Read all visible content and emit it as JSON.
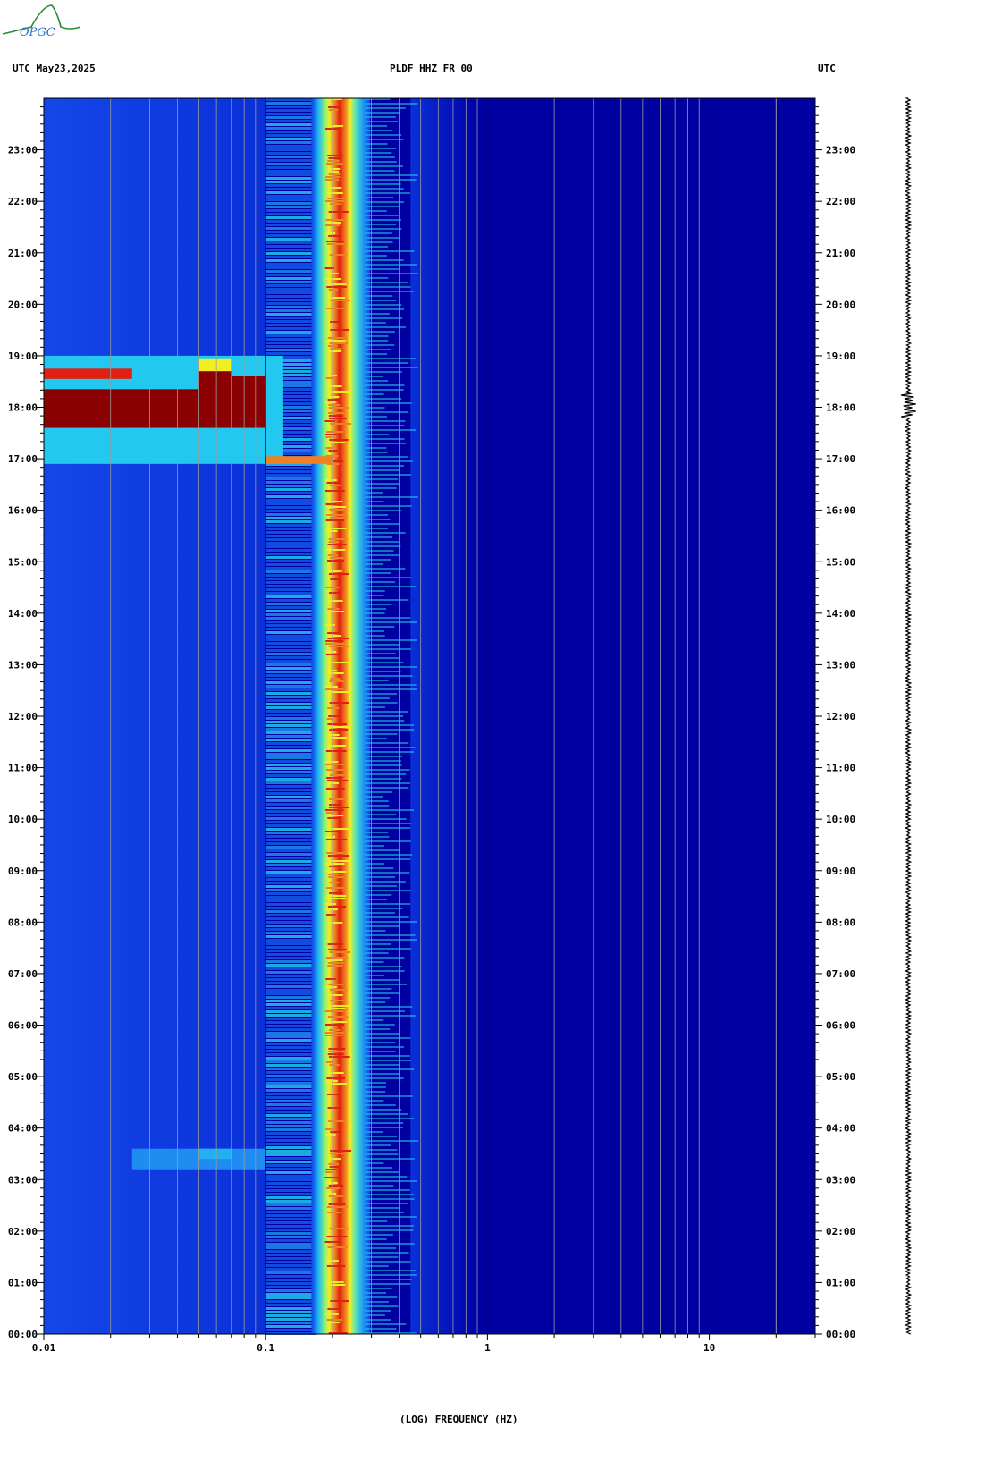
{
  "header": {
    "left_label": "UTC  May23,2025",
    "center_label": "PLDF HHZ FR 00",
    "right_label": "UTC"
  },
  "logo": {
    "text": "OPGC"
  },
  "colors": {
    "background_plot": "#0000a0",
    "low": "#0d3fe8",
    "mid_cyan": "#22c8f0",
    "mid_yellow": "#f0f020",
    "high_red": "#e02010",
    "max_darkred": "#8b0000",
    "gridline": "#9a9a9a"
  },
  "chart_data": {
    "type": "heatmap",
    "title": "PLDF HHZ FR 00",
    "date": "May23,2025",
    "xlabel": "(LOG) FREQUENCY (HZ)",
    "ylabel": "UTC",
    "x_scale": "log",
    "xlim": [
      0.01,
      30
    ],
    "x_tick_labels": [
      "0.01",
      "0.1",
      "1",
      "10"
    ],
    "ylim_hours": [
      0,
      24
    ],
    "y_tick_labels": [
      "00:00",
      "01:00",
      "02:00",
      "03:00",
      "04:00",
      "05:00",
      "06:00",
      "07:00",
      "08:00",
      "09:00",
      "10:00",
      "11:00",
      "12:00",
      "13:00",
      "14:00",
      "15:00",
      "16:00",
      "17:00",
      "18:00",
      "19:00",
      "20:00",
      "21:00",
      "22:00",
      "23:00"
    ],
    "bands": [
      {
        "name": "microseism_peak_hz",
        "from": 0.17,
        "to": 0.28,
        "level": "high",
        "hours": [
          0,
          24
        ]
      },
      {
        "name": "secondary_energy_hz",
        "from": 0.1,
        "to": 0.45,
        "level": "mid",
        "hours": [
          0,
          24
        ]
      },
      {
        "name": "earthquake_event_hz",
        "from": 0.01,
        "to": 0.1,
        "level": "max",
        "hours": [
          17.6,
          18.35
        ]
      },
      {
        "name": "event_coda_hz",
        "from": 0.01,
        "to": 0.12,
        "level": "mid",
        "hours": [
          16.9,
          19.0
        ]
      },
      {
        "name": "small_event_hz",
        "from": 0.025,
        "to": 0.1,
        "level": "low_mid",
        "hours": [
          3.2,
          3.6
        ]
      }
    ],
    "seismogram_event_hours": [
      17.8,
      18.3
    ]
  }
}
